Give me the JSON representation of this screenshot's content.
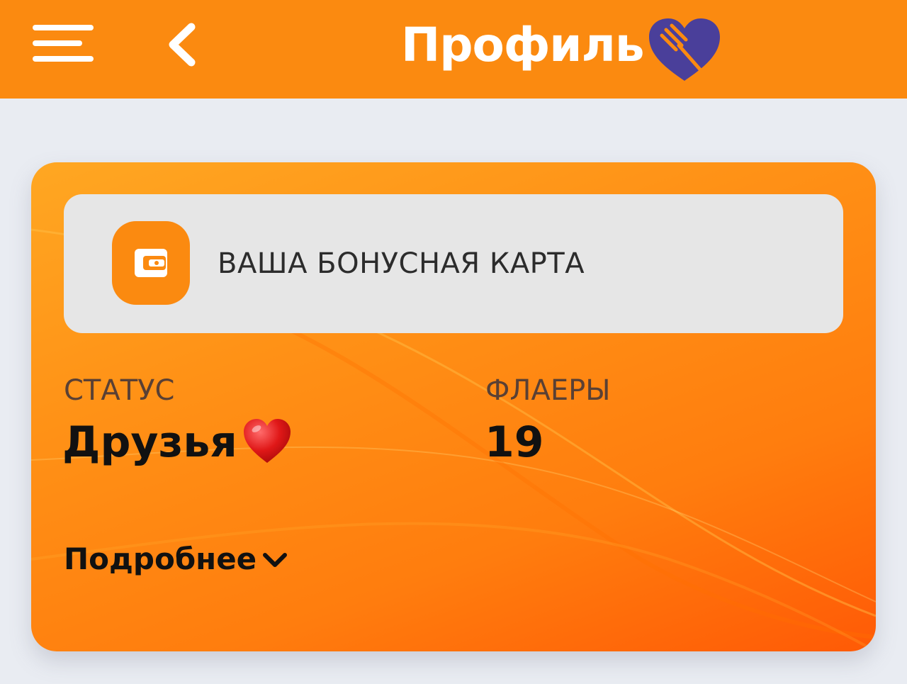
{
  "header": {
    "title": "Профиль",
    "menu_icon": "hamburger-menu-icon",
    "back_icon": "chevron-left-icon",
    "logo_icon": "heart-fork-logo",
    "background_color": "#fb8a10"
  },
  "card": {
    "bonus": {
      "label": "ВАША БОНУСНАЯ КАРТА",
      "icon": "wallet-icon"
    },
    "status": {
      "label": "СТАТУС",
      "value": "Друзья",
      "emoji": "red-heart-icon"
    },
    "flyers": {
      "label": "ФЛАЕРЫ",
      "value": "19"
    },
    "details": {
      "label": "Подробнее",
      "icon": "chevron-down-icon"
    },
    "accent_color": "#ff8a10"
  }
}
